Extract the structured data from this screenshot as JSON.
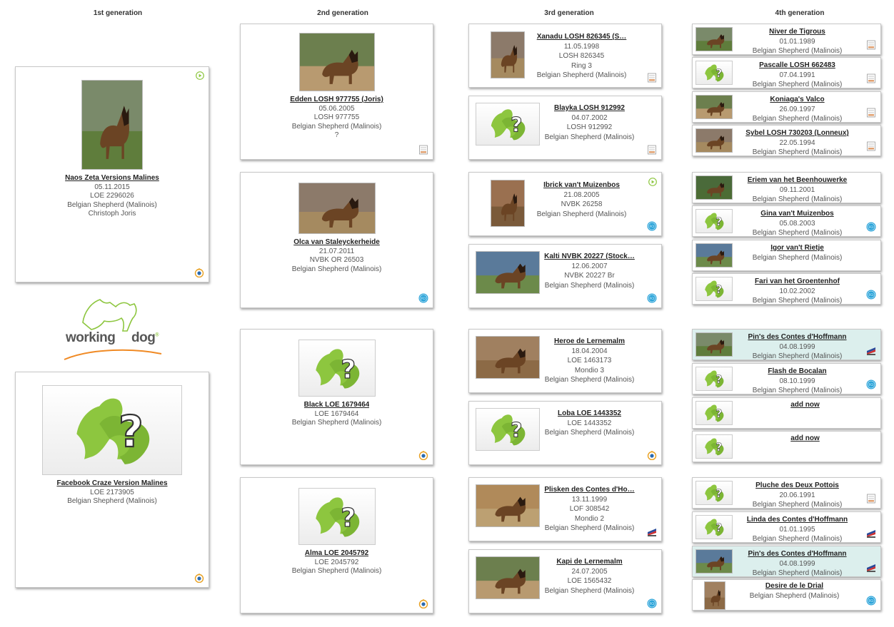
{
  "headers": [
    "1st generation",
    "2nd generation",
    "3rd generation",
    "4th generation"
  ],
  "logo": {
    "word1": "working",
    "word2": "dog",
    "mark": "®"
  },
  "colors": {
    "accent_green": "#8dc63f",
    "highlight_row": "#dcefed",
    "fci_blue": "#29a3d9",
    "kennel_orange": "#e8a020"
  },
  "gen1": [
    {
      "name": "Naos Zeta Versions Malines",
      "lines": [
        "05.11.2015",
        "LOE 2296026",
        "Belgian Shepherd (Malinois)",
        "Christoph Joris"
      ],
      "photo": "dog-photo",
      "badge": "kennel-club-badge-icon",
      "video": true
    },
    {
      "name": "Facebook Craze Version Malines",
      "lines": [
        "LOE 2173905",
        "Belgian Shepherd (Malinois)"
      ],
      "photo": "placeholder",
      "badge": "kennel-club-badge-icon"
    }
  ],
  "gen2": [
    {
      "name": "Edden LOSH 977755 (Joris)",
      "lines": [
        "05.06.2005",
        "LOSH 977755",
        "Belgian Shepherd (Malinois)",
        "?"
      ],
      "photo": "dog-photo",
      "badge": "pedigree-doc-icon"
    },
    {
      "name": "Olca van Staleyckerheide",
      "lines": [
        "21.07.2011",
        "NVBK OR 26503",
        "Belgian Shepherd (Malinois)"
      ],
      "photo": "dog-photo",
      "badge": "fci-badge-icon"
    },
    {
      "name": "Black LOE 1679464",
      "lines": [
        "LOE 1679464",
        "Belgian Shepherd (Malinois)"
      ],
      "photo": "placeholder",
      "badge": "kennel-club-badge-icon"
    },
    {
      "name": "Alma LOE 2045792",
      "lines": [
        "LOE 2045792",
        "Belgian Shepherd (Malinois)"
      ],
      "photo": "placeholder",
      "badge": "kennel-club-badge-icon"
    }
  ],
  "gen3": [
    {
      "name": "Xanadu LOSH 826345 (S…",
      "lines": [
        "11.05.1998",
        "LOSH 826345",
        "Ring 3",
        "Belgian Shepherd (Malinois)"
      ],
      "photo": "dog-photo",
      "badge": "pedigree-doc-icon"
    },
    {
      "name": "Blayka LOSH 912992",
      "lines": [
        "04.07.2002",
        "LOSH 912992",
        "Belgian Shepherd (Malinois)"
      ],
      "photo": "placeholder",
      "badge": "pedigree-doc-icon"
    },
    {
      "name": "Ibrick van't Muizenbos",
      "lines": [
        "21.08.2005",
        "NVBK 26258",
        "Belgian Shepherd (Malinois)"
      ],
      "photo": "dog-photo",
      "badge": "fci-badge-icon",
      "video": true
    },
    {
      "name": "Kalti NVBK 20227 (Stock…",
      "lines": [
        "12.06.2007",
        "NVBK 20227 Br",
        "Belgian Shepherd (Malinois)"
      ],
      "photo": "dog-photo",
      "badge": "fci-badge-icon"
    },
    {
      "name": "Heroe de Lernemalm",
      "lines": [
        "18.04.2004",
        "LOE 1463173",
        "Mondio 3",
        "Belgian Shepherd (Malinois)"
      ],
      "photo": "dog-photo",
      "badge": ""
    },
    {
      "name": "Loba LOE 1443352",
      "lines": [
        "LOE 1443352",
        "Belgian Shepherd (Malinois)"
      ],
      "photo": "placeholder",
      "badge": "kennel-club-badge-icon"
    },
    {
      "name": "Plisken des Contes d'Ho…",
      "lines": [
        "13.11.1999",
        "LOF 308542",
        "Mondio 2",
        "Belgian Shepherd (Malinois)"
      ],
      "photo": "dog-photo",
      "badge": "french-kennel-badge-icon"
    },
    {
      "name": "Kapi de Lernemalm",
      "lines": [
        "24.07.2005",
        "LOE 1565432",
        "Belgian Shepherd (Malinois)"
      ],
      "photo": "dog-photo",
      "badge": "fci-badge-icon"
    }
  ],
  "gen4": [
    {
      "name": "Niver de Tigrous",
      "lines": [
        "01.01.1989",
        "Belgian Shepherd (Malinois)"
      ],
      "photo": "dog-photo",
      "badge": "pedigree-doc-icon"
    },
    {
      "name": "Pascalle LOSH 662483",
      "lines": [
        "07.04.1991",
        "Belgian Shepherd (Malinois)"
      ],
      "photo": "placeholder",
      "badge": "pedigree-doc-icon"
    },
    {
      "name": "Koniaga's Valco",
      "lines": [
        "26.09.1997",
        "Belgian Shepherd (Malinois)"
      ],
      "photo": "dog-photo",
      "badge": "pedigree-doc-icon"
    },
    {
      "name": "Sybel LOSH 730203 (Lonneux)",
      "lines": [
        "22.05.1994",
        "Belgian Shepherd (Malinois)"
      ],
      "photo": "dog-photo",
      "badge": "pedigree-doc-icon"
    },
    {
      "name": "Eriem van het Beenhouwerke",
      "lines": [
        "09.11.2001",
        "Belgian Shepherd (Malinois)"
      ],
      "photo": "dog-photo",
      "badge": ""
    },
    {
      "name": "Gina van't Muizenbos",
      "lines": [
        "05.08.2003",
        "Belgian Shepherd (Malinois)"
      ],
      "photo": "placeholder",
      "badge": "fci-badge-icon"
    },
    {
      "name": "Igor van't Rietje",
      "lines": [
        "Belgian Shepherd (Malinois)"
      ],
      "photo": "dog-photo",
      "badge": ""
    },
    {
      "name": "Fari van het Groentenhof",
      "lines": [
        "10.02.2002",
        "Belgian Shepherd (Malinois)"
      ],
      "photo": "placeholder",
      "badge": "fci-badge-icon"
    },
    {
      "name": "Pin's des Contes d'Hoffmann",
      "lines": [
        "04.08.1999",
        "Belgian Shepherd (Malinois)"
      ],
      "photo": "dog-photo",
      "badge": "french-kennel-badge-icon",
      "highlight": true
    },
    {
      "name": "Flash de Bocalan",
      "lines": [
        "08.10.1999",
        "Belgian Shepherd (Malinois)"
      ],
      "photo": "placeholder",
      "badge": "fci-badge-icon"
    },
    {
      "name": "",
      "lines": [],
      "photo": "placeholder",
      "badge": "",
      "add": "add now"
    },
    {
      "name": "",
      "lines": [],
      "photo": "placeholder",
      "badge": "",
      "add": "add now"
    },
    {
      "name": "Pluche des Deux Pottois",
      "lines": [
        "20.06.1991",
        "Belgian Shepherd (Malinois)"
      ],
      "photo": "placeholder",
      "badge": "pedigree-doc-icon"
    },
    {
      "name": "Linda des Contes d'Hoffmann",
      "lines": [
        "01.01.1995",
        "Belgian Shepherd (Malinois)"
      ],
      "photo": "placeholder",
      "badge": "french-kennel-badge-icon"
    },
    {
      "name": "Pin's des Contes d'Hoffmann",
      "lines": [
        "04.08.1999",
        "Belgian Shepherd (Malinois)"
      ],
      "photo": "dog-photo",
      "badge": "french-kennel-badge-icon",
      "highlight": true
    },
    {
      "name": "Desire de le Drial",
      "lines": [
        "Belgian Shepherd (Malinois)"
      ],
      "photo": "dog-photo",
      "badge": "fci-badge-icon"
    }
  ]
}
